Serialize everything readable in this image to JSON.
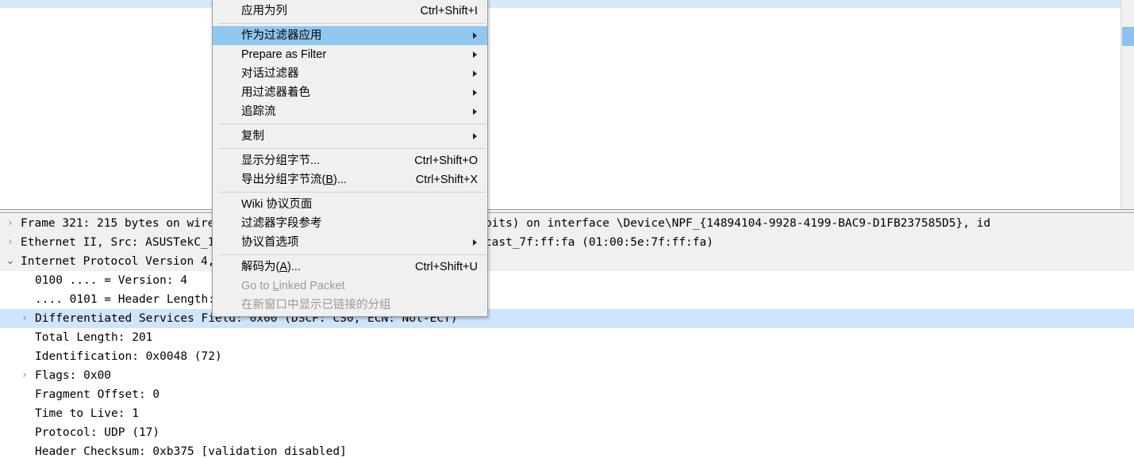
{
  "app": {
    "name": "wireshark-packet-detail-context-menu"
  },
  "packet_list": {
    "selected_row_fragment": "",
    "scrollbar": {
      "name": "vertical-scrollbar"
    }
  },
  "packet_detail": {
    "rows": [
      {
        "twisty": "collapsed",
        "indent": 0,
        "text": "Frame 321: 215 bytes on wire (1720 bits), 215 bytes captured (1720 bits) on interface \\Device\\NPF_{14894104-9928-4199-BAC9-D1FB237585D5}, id",
        "style": "head"
      },
      {
        "twisty": "collapsed",
        "indent": 0,
        "text": "Ethernet II, Src: ASUSTekC_1b:27:64 (1c:87:2c:1b:27:64), Dst: IPv4mcast_7f:ff:fa (01:00:5e:7f:ff:fa)",
        "style": "head"
      },
      {
        "twisty": "expanded",
        "indent": 0,
        "text": "Internet Protocol Version 4, Src: 192.168.1.7, Dst: 239.255.255.250",
        "style": "head"
      },
      {
        "twisty": "none",
        "indent": 2,
        "text": "0100 .... = Version: 4",
        "style": "plain"
      },
      {
        "twisty": "none",
        "indent": 2,
        "text": ".... 0101 = Header Length: 20 bytes (5)",
        "style": "plain"
      },
      {
        "twisty": "collapsed",
        "indent": 1,
        "text": "Differentiated Services Field: 0x00 (DSCP: CS0, ECN: Not-ECT)",
        "style": "selected"
      },
      {
        "twisty": "none",
        "indent": 2,
        "text": "Total Length: 201",
        "style": "plain"
      },
      {
        "twisty": "none",
        "indent": 2,
        "text": "Identification: 0x0048 (72)",
        "style": "plain"
      },
      {
        "twisty": "collapsed",
        "indent": 1,
        "text": "Flags: 0x00",
        "style": "plain"
      },
      {
        "twisty": "none",
        "indent": 2,
        "text": "Fragment Offset: 0",
        "style": "plain"
      },
      {
        "twisty": "none",
        "indent": 2,
        "text": "Time to Live: 1",
        "style": "plain"
      },
      {
        "twisty": "none",
        "indent": 2,
        "text": "Protocol: UDP (17)",
        "style": "plain"
      },
      {
        "twisty": "none",
        "indent": 2,
        "text": "Header Checksum: 0xb375 [validation disabled]",
        "style": "plain"
      }
    ]
  },
  "context_menu": {
    "items": [
      {
        "type": "item",
        "label": "应用为列",
        "shortcut": "Ctrl+Shift+I",
        "submenu": false,
        "disabled": false,
        "highlighted": false
      },
      {
        "type": "separator"
      },
      {
        "type": "item",
        "label": "作为过滤器应用",
        "shortcut": "",
        "submenu": true,
        "disabled": false,
        "highlighted": true
      },
      {
        "type": "item",
        "label": "Prepare as Filter",
        "shortcut": "",
        "submenu": true,
        "disabled": false,
        "highlighted": false
      },
      {
        "type": "item",
        "label": "对话过滤器",
        "shortcut": "",
        "submenu": true,
        "disabled": false,
        "highlighted": false
      },
      {
        "type": "item",
        "label": "用过滤器着色",
        "shortcut": "",
        "submenu": true,
        "disabled": false,
        "highlighted": false
      },
      {
        "type": "item",
        "label": "追踪流",
        "shortcut": "",
        "submenu": true,
        "disabled": false,
        "highlighted": false
      },
      {
        "type": "separator"
      },
      {
        "type": "item",
        "label": "复制",
        "shortcut": "",
        "submenu": true,
        "disabled": false,
        "highlighted": false
      },
      {
        "type": "separator"
      },
      {
        "type": "item",
        "label": "显示分组字节...",
        "shortcut": "Ctrl+Shift+O",
        "submenu": false,
        "disabled": false,
        "highlighted": false
      },
      {
        "type": "item",
        "label": "导出分组字节流(B)...",
        "shortcut": "Ctrl+Shift+X",
        "submenu": false,
        "disabled": false,
        "highlighted": false
      },
      {
        "type": "separator"
      },
      {
        "type": "item",
        "label": "Wiki 协议页面",
        "shortcut": "",
        "submenu": false,
        "disabled": false,
        "highlighted": false
      },
      {
        "type": "item",
        "label": "过滤器字段参考",
        "shortcut": "",
        "submenu": false,
        "disabled": false,
        "highlighted": false
      },
      {
        "type": "item",
        "label": "协议首选项",
        "shortcut": "",
        "submenu": true,
        "disabled": false,
        "highlighted": false
      },
      {
        "type": "separator"
      },
      {
        "type": "item",
        "label": "解码为(A)...",
        "shortcut": "Ctrl+Shift+U",
        "submenu": false,
        "disabled": false,
        "highlighted": false
      },
      {
        "type": "item",
        "label": "Go to Linked Packet",
        "shortcut": "",
        "submenu": false,
        "disabled": true,
        "highlighted": false
      },
      {
        "type": "item",
        "label": "在新窗口中显示已链接的分组",
        "shortcut": "",
        "submenu": false,
        "disabled": true,
        "highlighted": false
      }
    ]
  },
  "colors": {
    "menu_background": "#f0f0f0",
    "menu_highlight": "#8fc7ef",
    "detail_selected": "#cfe5fb",
    "list_selected": "#dae8fb",
    "detail_header_bg": "#f0f0f0",
    "disabled_text": "#9a9a9a"
  }
}
